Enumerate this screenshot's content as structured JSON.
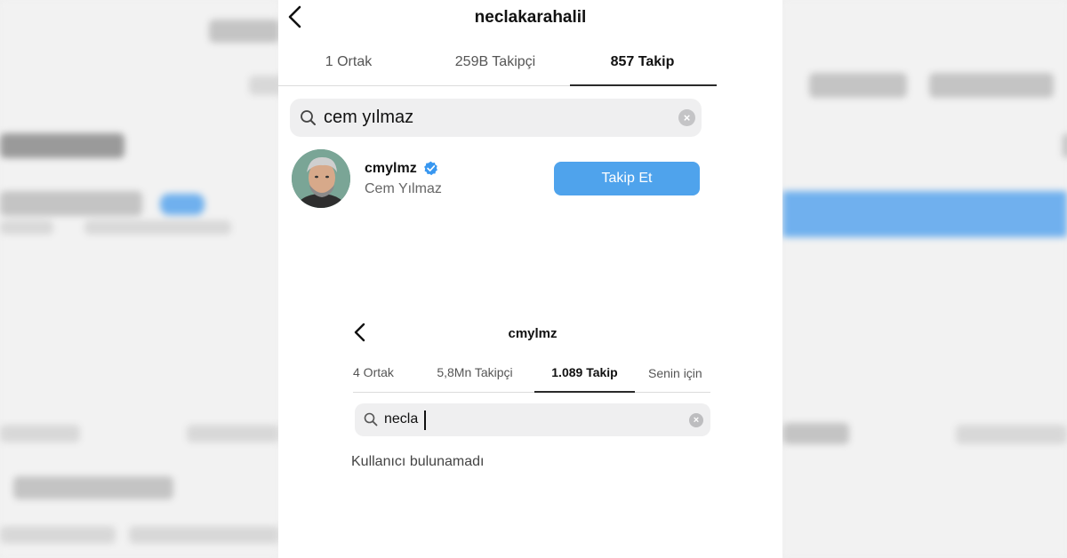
{
  "top": {
    "username": "neclakarahalil",
    "tabs": [
      "1 Ortak",
      "259B Takipçi",
      "857 Takip"
    ],
    "active_tab": 2,
    "search_value": "cem yılmaz",
    "result": {
      "username": "cmylmz",
      "full_name": "Cem Yılmaz",
      "verified": true,
      "follow_label": "Takip Et"
    }
  },
  "bottom": {
    "username": "cmylmz",
    "tabs": [
      "4 Ortak",
      "5,8Mn Takipçi",
      "1.089 Takip",
      "Senin için"
    ],
    "active_tab": 2,
    "search_value": "necla",
    "empty_message": "Kullanıcı bulunamadı"
  },
  "colors": {
    "accent": "#4fa3ec",
    "verified": "#3897f0"
  },
  "icons": [
    "back-arrow-icon",
    "search-icon",
    "clear-icon",
    "verified-badge-icon"
  ]
}
